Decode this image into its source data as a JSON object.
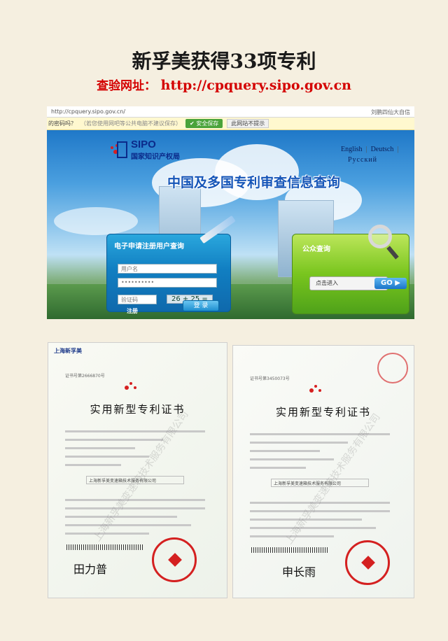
{
  "header": {
    "title": "新孚美获得33项专利",
    "query_label": "查验网址：",
    "query_url": "http://cpquery.sipo.gov.cn"
  },
  "browser": {
    "address": "http://cpquery.sipo.gov.cn/",
    "address_right": "刘鹏四仙大自信",
    "notice_text": "的密码吗？",
    "notice_gray": "（若您使用网吧等公共电脑不建议保存）",
    "safe_save": "安全保存",
    "no_prompt": "此网站不提示",
    "logo_en": "SIPO",
    "logo_cn": "国家知识产权局",
    "lang_1": "English",
    "lang_2": "Deutsch",
    "lang_3": "Русский",
    "hero_title": "中国及多国专利审查信息查询",
    "left_panel_title": "电子申请注册用户查询",
    "username_placeholder": "用户名",
    "password_value": "••••••••••",
    "captcha_placeholder": "验证码",
    "captcha_text": "26 + 25 =",
    "register_label": "注册",
    "login_button": "登 录",
    "right_panel_title": "公众查询",
    "enter_label": "点击进入",
    "go_button": "GO"
  },
  "certificates": {
    "title": "实用新型专利证书",
    "left": {
      "logo": "上海新孚美",
      "cert_no": "证书号第2666870号",
      "company": "上海新孚美变速箱技术服务有限公司",
      "signature": "田力普",
      "watermark": "上海新孚美变速箱技术服务有限公司"
    },
    "right": {
      "cert_no": "证书号第3450073号",
      "company": "上海新孚美变速箱技术服务有限公司",
      "signature": "申长雨",
      "watermark": "上海新孚美变速箱技术服务有限公司"
    }
  }
}
